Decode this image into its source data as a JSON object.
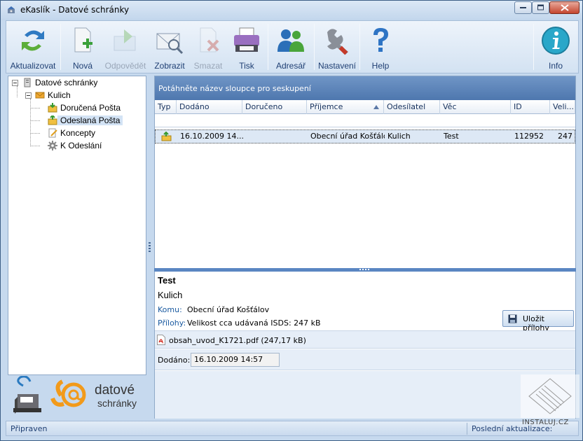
{
  "window": {
    "title": "eKaslík - Datové schránky",
    "controls": [
      "minimize",
      "maximize",
      "close"
    ]
  },
  "toolbar": {
    "items": [
      {
        "label": "Aktualizovat",
        "icon": "refresh-arrows-icon",
        "enabled": true
      },
      {
        "label": "Nová",
        "icon": "new-document-icon",
        "enabled": true
      },
      {
        "label": "Odpovědět",
        "icon": "reply-icon",
        "enabled": false
      },
      {
        "label": "Zobrazit",
        "icon": "view-envelope-icon",
        "enabled": true
      },
      {
        "label": "Smazat",
        "icon": "delete-icon",
        "enabled": false
      },
      {
        "label": "Tisk",
        "icon": "printer-icon",
        "enabled": true
      },
      {
        "label": "Adresář",
        "icon": "contacts-icon",
        "enabled": true
      },
      {
        "label": "Nastavení",
        "icon": "settings-wrench-icon",
        "enabled": true
      },
      {
        "label": "Help",
        "icon": "help-icon",
        "enabled": true
      },
      {
        "label": "Info",
        "icon": "info-icon",
        "enabled": true
      }
    ]
  },
  "tree": {
    "root": "Datové schránky",
    "box": "Kulich",
    "folders": [
      {
        "label": "Doručená Pošta",
        "icon": "inbox-envelope-icon",
        "selected": false
      },
      {
        "label": "Odeslaná Pošta",
        "icon": "sent-envelope-icon",
        "selected": true
      },
      {
        "label": "Koncepty",
        "icon": "draft-icon",
        "selected": false
      },
      {
        "label": "K Odeslání",
        "icon": "gear-icon",
        "selected": false
      }
    ]
  },
  "logos": {
    "ekaslik": "eKaslík",
    "datove_line1": "datové",
    "datove_line2": "schránky"
  },
  "grid": {
    "group_hint": "Potáhněte název sloupce pro seskupení",
    "columns": [
      "Typ",
      "Dodáno",
      "Doručeno",
      "Příjemce",
      "Odesílatel",
      "Věc",
      "ID",
      "Veli..."
    ],
    "sorted_column": "Příjemce",
    "rows": [
      {
        "dodano": "16.10.2009  14...",
        "doruceno": "",
        "prijemce": "Obecní úřad Košťálov",
        "odesilatel": "Kulich",
        "vec": "Test",
        "id": "112952",
        "velikost": "247"
      }
    ]
  },
  "detail": {
    "subject": "Test",
    "from": "Kulich",
    "komu_label": "Komu:",
    "komu_value": "Obecní úřad Košťálov",
    "prilohy_label": "Přílohy:",
    "prilohy_value": "Velikost cca udávaná ISDS: 247 kB",
    "save_button": "Uložit přílohy",
    "attachment": "obsah_uvod_K1721.pdf (247,17 kB)",
    "dodano_label": "Dodáno:",
    "dodano_value": "16.10.2009 14:57"
  },
  "statusbar": {
    "left": "Připraven",
    "right": "Poslední aktualizace: "
  },
  "watermark": {
    "text": "INSTALUJ.CZ"
  }
}
